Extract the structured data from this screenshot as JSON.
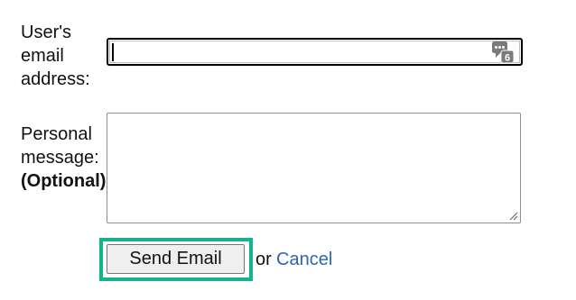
{
  "form": {
    "email_label_lines": [
      "User's",
      "email",
      "address:"
    ],
    "email_value": "",
    "email_placeholder": "",
    "password_manager_badge": "6",
    "message_label_lines": [
      "Personal",
      "message:"
    ],
    "message_optional": "(Optional)",
    "message_value": ""
  },
  "actions": {
    "send_label": "Send Email",
    "or_text": "or",
    "cancel_label": "Cancel"
  },
  "colors": {
    "focus_ring": "#14b38e",
    "link": "#2e63b8",
    "icon_badge": "#7a7a7a"
  },
  "icons": {
    "password_manager": "password-manager-icon",
    "resize_grip": "resize-grip-icon"
  }
}
